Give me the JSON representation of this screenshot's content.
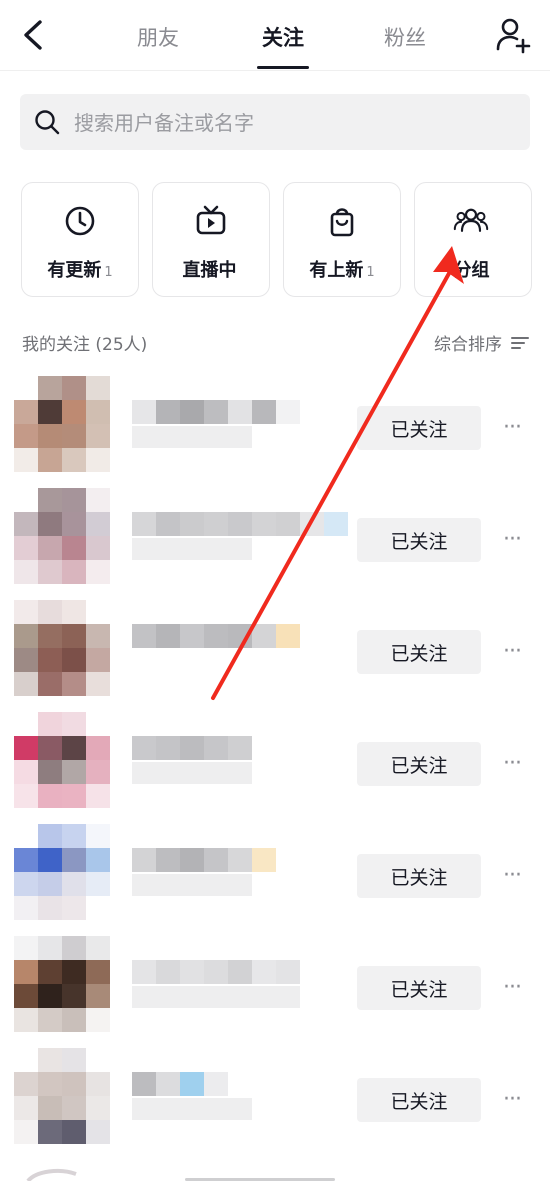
{
  "nav": {
    "tabs": [
      {
        "label": "朋友",
        "active": false
      },
      {
        "label": "关注",
        "active": true
      },
      {
        "label": "粉丝",
        "active": false
      }
    ],
    "back_icon": "chevron-left-icon",
    "add_user_icon": "add-user-icon"
  },
  "search": {
    "placeholder": "搜索用户备注或名字"
  },
  "cards": [
    {
      "label": "有更新",
      "badge": "1",
      "icon": "clock-icon"
    },
    {
      "label": "直播中",
      "badge": "",
      "icon": "tv-icon"
    },
    {
      "label": "有上新",
      "badge": "1",
      "icon": "shopping-bag-icon"
    },
    {
      "label": "分组",
      "badge": "",
      "icon": "group-icon"
    }
  ],
  "section": {
    "title": "我的关注 (25人)",
    "sort_label": "综合排序"
  },
  "follow_label": "已关注",
  "more_label": "···",
  "annotation": {
    "color": "#f02a1e"
  },
  "rows": [
    {
      "avatar": [
        "#ffffff",
        "#b8a49c",
        "#b09088",
        "#e3dbd6",
        "#c9a899",
        "#4f3b37",
        "#be8a72",
        "#d0beb1",
        "#c49a88",
        "#b58b76",
        "#b48c79",
        "#d3c0b4",
        "#f2ece8",
        "#c7a594",
        "#d9c8bd",
        "#f1ebe7"
      ],
      "name": [
        "#e6e6e8",
        "#b4b4b7",
        "#a9a9ac",
        "#bdbdc0",
        "#e2e2e4",
        "#b8b8bb",
        "#f2f2f3"
      ],
      "sub": 5
    },
    {
      "avatar": [
        "#ffffff",
        "#a8989a",
        "#a6949a",
        "#f3eef0",
        "#c3b7bc",
        "#8f7a7f",
        "#a8939b",
        "#d2ccd4",
        "#e3cdd4",
        "#c7a7ae",
        "#b98590",
        "#d9c8cf",
        "#efe6e9",
        "#dfc9cf",
        "#d9b5be",
        "#f4ecee"
      ],
      "name": [
        "#d6d6d8",
        "#c4c4c7",
        "#cbcbcd",
        "#cfcfd1",
        "#c9c9cc",
        "#d3d3d5",
        "#d0d0d2",
        "#e6e6e8",
        "#d5e8f6"
      ],
      "sub": 5
    },
    {
      "avatar": [
        "#f2eaea",
        "#e7dcdc",
        "#efe6e4",
        "#ffffff",
        "#aa9a8c",
        "#956e61",
        "#8c6256",
        "#c8b7b0",
        "#9d8a85",
        "#8d5e55",
        "#7c5049",
        "#c4a8a2",
        "#d8cfcc",
        "#9a6d68",
        "#b48d88",
        "#e8dedb"
      ],
      "name": [
        "#c2c2c5",
        "#b5b5b8",
        "#c7c7ca",
        "#bcbcbf",
        "#b9b9bc",
        "#d4d4d6",
        "#f8e1b8"
      ],
      "sub": 0
    },
    {
      "avatar": [
        "#ffffff",
        "#f0d4dc",
        "#f1dbe2",
        "#ffffff",
        "#d03b66",
        "#8a5a64",
        "#5c4446",
        "#e3a9b8",
        "#f5dbe3",
        "#8e7d7f",
        "#b1a7a6",
        "#e5b1bf",
        "#f7e3e9",
        "#e9b1c1",
        "#eab3c2",
        "#f6e2e8"
      ],
      "name": [
        "#c9c9cc",
        "#c4c4c7",
        "#bcbcbf",
        "#c6c6c9",
        "#cfcfd1"
      ],
      "sub": 5
    },
    {
      "avatar": [
        "#ffffff",
        "#b8c6ea",
        "#c7d3ef",
        "#f4f6fb",
        "#6a86d6",
        "#3f63c8",
        "#8b97c2",
        "#a9c6ea",
        "#cdd6ee",
        "#c5cde8",
        "#e0e0ea",
        "#e6ecf6",
        "#f2f0f3",
        "#e9e3e7",
        "#ede7ea",
        "#ffffff"
      ],
      "name": [
        "#d3d3d5",
        "#bdbdc0",
        "#b3b3b6",
        "#c5c5c8",
        "#d7d7d9",
        "#f9e7c4"
      ],
      "sub": 5
    },
    {
      "avatar": [
        "#f3f3f4",
        "#e6e6e8",
        "#cfcdd0",
        "#e9e9ea",
        "#b7866a",
        "#5e4032",
        "#3e2b22",
        "#8e6a57",
        "#6c4a38",
        "#2f221c",
        "#47342b",
        "#a88a78",
        "#e9e4e1",
        "#d4cbc6",
        "#c9bfba",
        "#f5f3f2"
      ],
      "name": [
        "#e4e4e6",
        "#d9d9db",
        "#e1e1e3",
        "#dcdcde",
        "#d2d2d4",
        "#e7e7e9",
        "#e3e3e5"
      ],
      "sub": 7
    },
    {
      "avatar": [
        "#ffffff",
        "#e9e4e3",
        "#e5e3e6",
        "#ffffff",
        "#dcd3d0",
        "#d2c6c1",
        "#cfc3be",
        "#e7e3e2",
        "#ece8e7",
        "#c8bdb7",
        "#d0c6c2",
        "#ebe8e7",
        "#f4f2f2",
        "#6c6a7a",
        "#5f5d6e",
        "#e4e3e7"
      ],
      "name": [
        "#bcbcbf",
        "#dcdcde",
        "#9fd0ee",
        "#ececee"
      ],
      "sub": 5
    }
  ]
}
